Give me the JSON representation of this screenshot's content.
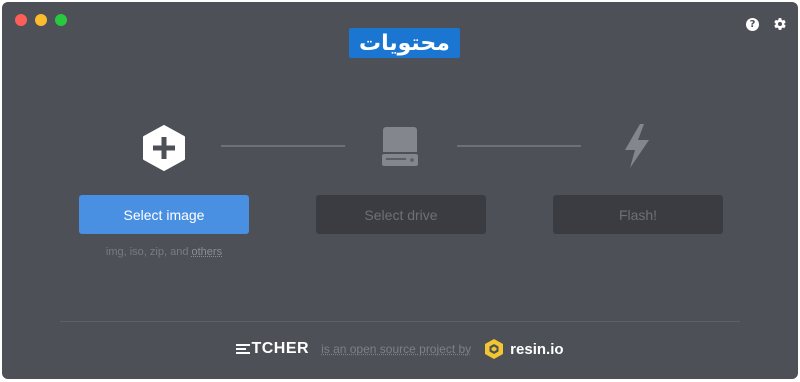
{
  "window": {
    "brand_badge": "محتويات"
  },
  "icons": {
    "help": "?",
    "settings": "gear-icon"
  },
  "steps": [
    {
      "label": "Select image",
      "icon": "plus-hexagon-icon",
      "state": "active"
    },
    {
      "label": "Select drive",
      "icon": "drive-icon",
      "state": "disabled"
    },
    {
      "label": "Flash!",
      "icon": "lightning-icon",
      "state": "disabled"
    }
  ],
  "formats": {
    "text": "img, iso, zip, and ",
    "link": "others"
  },
  "footer": {
    "logo": "TCHER",
    "text": "is an open source project by",
    "company": "resin.io"
  },
  "colors": {
    "background": "#4d5056",
    "accent": "#4a90e2",
    "brand_badge": "#1b76d2",
    "disabled_button": "#3a3c41",
    "resin_yellow": "#f4c531"
  }
}
